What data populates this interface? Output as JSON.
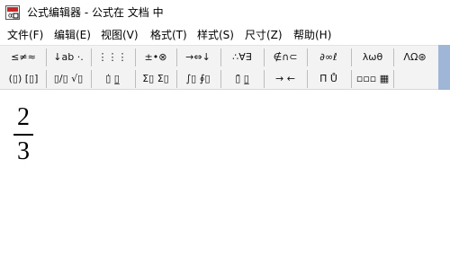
{
  "window": {
    "title": "公式编辑器 - 公式在 文档 中"
  },
  "menu": {
    "items": [
      {
        "label": "文件(F)"
      },
      {
        "label": "编辑(E)"
      },
      {
        "label": "视图(V)"
      },
      {
        "label": "格式(T)"
      },
      {
        "label": "样式(S)"
      },
      {
        "label": "尺寸(Z)"
      },
      {
        "label": "帮助(H)"
      }
    ]
  },
  "toolbar": {
    "row1": [
      {
        "label": "≤≠≈"
      },
      {
        "label": "↓ab ·."
      },
      {
        "label": "⋮⋮⋮"
      },
      {
        "label": "±•⊗"
      },
      {
        "label": "→⇔↓"
      },
      {
        "label": "∴∀∃"
      },
      {
        "label": "∉∩⊂"
      },
      {
        "label": "∂∞ℓ"
      },
      {
        "label": "λωθ"
      },
      {
        "label": "ΛΩ⊛"
      }
    ],
    "row2": [
      {
        "label": "(▯) [▯]"
      },
      {
        "label": "▯/▯ √▯"
      },
      {
        "label": "▯̇ ▯̲"
      },
      {
        "label": "Σ▯ Σ▯"
      },
      {
        "label": "∫▯ ∮▯"
      },
      {
        "label": "▯̄ ▯̲"
      },
      {
        "label": "→ ←"
      },
      {
        "label": "Π̄ Ů"
      },
      {
        "label": "▫▫▫ ▦"
      }
    ]
  },
  "editor": {
    "numerator": "2",
    "denominator": "3"
  },
  "colors": {
    "toolbar_bg": "#f3f3f3",
    "scrollbar_accent": "#9fb6d6",
    "app_icon_red": "#c62828"
  },
  "icons": {
    "app": "equation-editor-icon"
  }
}
